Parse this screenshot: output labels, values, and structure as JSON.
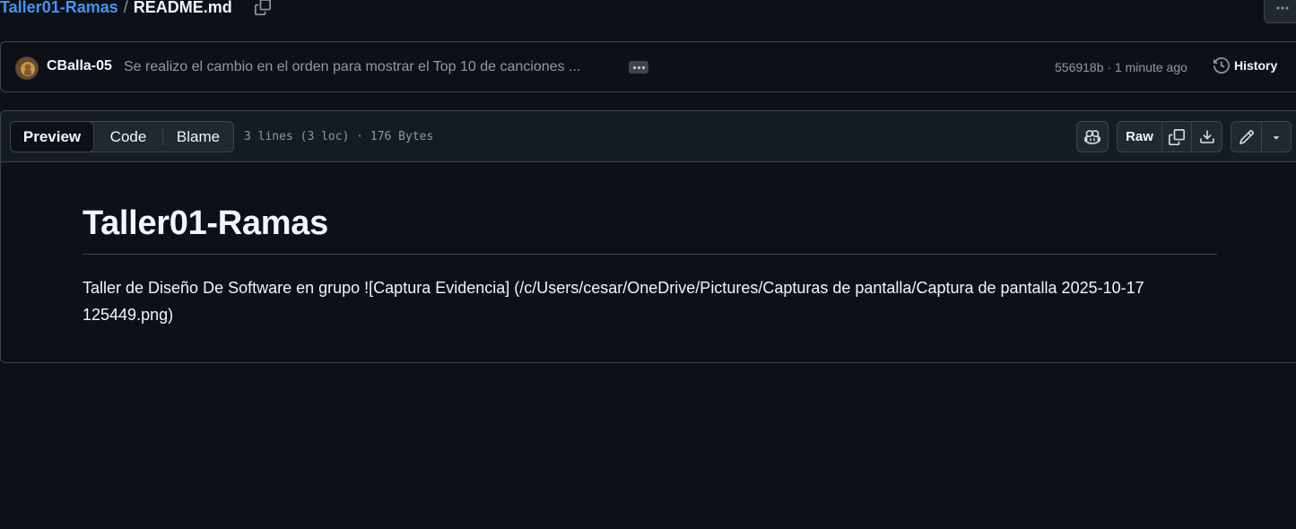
{
  "breadcrumb": {
    "repo": "Taller01-Ramas",
    "separator": "/",
    "file": "README.md"
  },
  "commit": {
    "author": "CBalla-05",
    "message": "Se realizo el cambio en el orden para mostrar el Top 10 de canciones ...",
    "sha_time": "556918b · 1 minute ago",
    "history_label": "History"
  },
  "file_header": {
    "tabs": [
      "Preview",
      "Code",
      "Blame"
    ],
    "info": "3 lines (3 loc) · 176 Bytes",
    "raw_label": "Raw"
  },
  "readme": {
    "title": "Taller01-Ramas",
    "body": "Taller de Diseño De Software en grupo ![Captura Evidencia] (/c/Users/cesar/OneDrive/Pictures/Capturas de pantalla/Captura de pantalla 2025-10-17 125449.png)"
  },
  "icons": {
    "copy_path": "copy-icon",
    "more": "kebab-horizontal-icon",
    "history": "history-icon",
    "copilot": "copilot-icon",
    "copy_raw": "copy-icon",
    "download": "download-icon",
    "edit": "pencil-icon",
    "dropdown": "triangle-down-icon"
  },
  "colors": {
    "background": "#0d1117",
    "link": "#4493f8",
    "muted": "#9198a1",
    "border": "#3d444d"
  }
}
